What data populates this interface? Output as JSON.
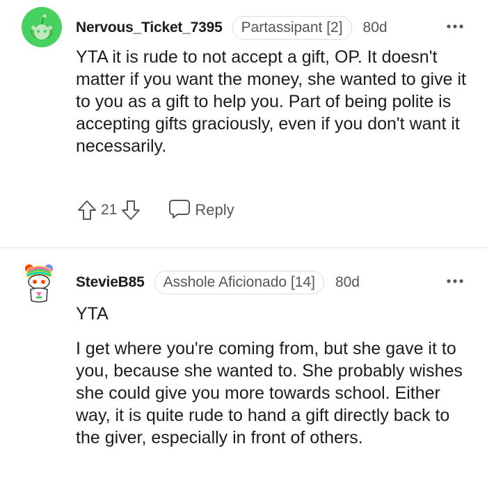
{
  "comments": [
    {
      "username": "Nervous_Ticket_7395",
      "flair": "Partassipant [2]",
      "age": "80d",
      "body": "YTA it is rude to not accept a gift, OP. It doesn't matter if you want the money, she wanted to give it to you as a gift to help you. Part of being polite is accepting gifts graciously, even if you don't want it necessarily.",
      "score": "21",
      "reply_label": "Reply",
      "avatar_icon": "snoo-avatar-icon",
      "avatar_color": "#46d160"
    },
    {
      "username": "StevieB85",
      "flair": "Asshole Aficionado [14]",
      "age": "80d",
      "body_line1": "YTA",
      "body_line2": "I get where you're coming from, but she gave it to you, because she wanted to. She probably wishes she could give you more towards school. Either way, it is quite rude to hand a gift directly back to the giver, especially in front of others.",
      "avatar_icon": "rainbow-snoo-avatar-icon"
    }
  ],
  "icons": {
    "more": "more-options-icon",
    "upvote": "upvote-icon",
    "downvote": "downvote-icon",
    "reply": "reply-icon"
  },
  "colors": {
    "text": "#1c1c1c",
    "meta": "#555555",
    "divider": "#edeff1"
  }
}
